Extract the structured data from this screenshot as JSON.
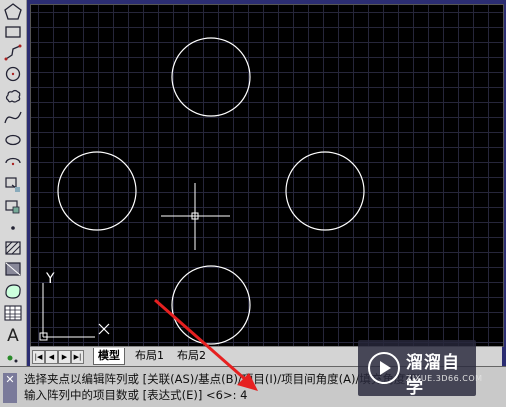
{
  "toolbar": {
    "text_tool_label": "A",
    "icons": [
      "pentagon-icon",
      "rectangle-icon",
      "polyline-icon",
      "circle-icon",
      "revision-cloud-icon",
      "spline-icon",
      "ellipse-icon",
      "ellipse-arc-icon",
      "insert-block-icon",
      "make-block-icon",
      "point-icon",
      "hatch-icon",
      "gradient-icon",
      "region-icon",
      "table-icon",
      "multiline-text-icon"
    ]
  },
  "canvas": {
    "ucs_y_label": "Y",
    "ucs_x_label": "X",
    "colors": {
      "background": "#000000",
      "geometry": "#ffffff",
      "grid": "#26263a"
    }
  },
  "tabs": {
    "items": [
      "模型",
      "布局1",
      "布局2"
    ],
    "active": "模型"
  },
  "command": {
    "line1": "选择夹点以编辑阵列或 [关联(AS)/基点(B)/项目(I)/项目间角度(A)/填充角度(F)",
    "line2": "输入阵列中的项目数或 [表达式(E)] <6>: 4"
  },
  "watermark": {
    "title": "溜溜自学",
    "url": "ZIXUE.3D66.COM"
  },
  "annotation": {
    "arrow_color": "#e62020"
  }
}
